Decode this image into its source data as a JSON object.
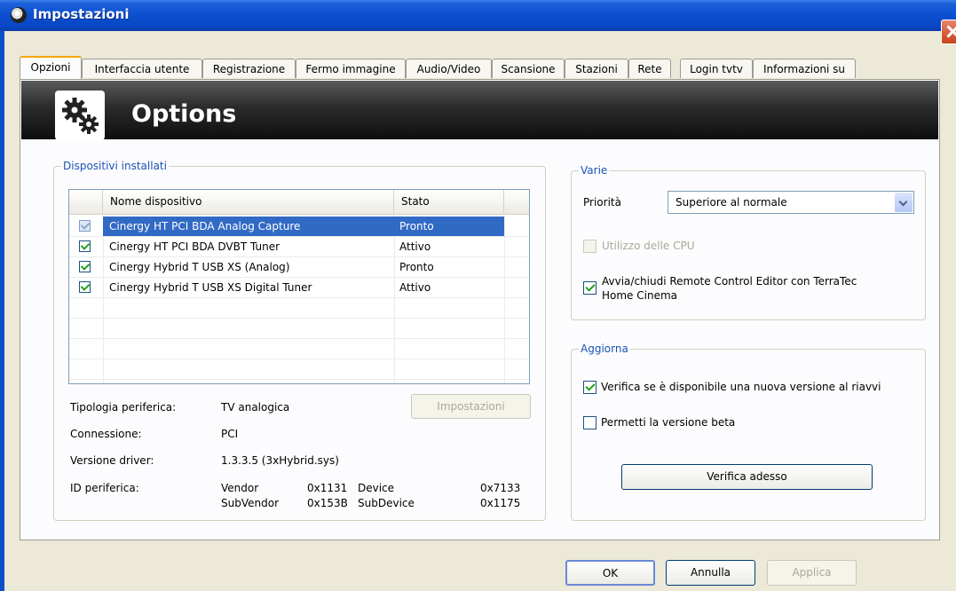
{
  "window": {
    "title": "Impostazioni"
  },
  "tabs": [
    {
      "label": "Opzioni",
      "active": true
    },
    {
      "label": "Interfaccia utente"
    },
    {
      "label": "Registrazione"
    },
    {
      "label": "Fermo immagine"
    },
    {
      "label": "Audio/Video"
    },
    {
      "label": "Scansione"
    },
    {
      "label": "Stazioni"
    },
    {
      "label": "Rete"
    },
    {
      "label": "Login tvtv"
    },
    {
      "label": "Informazioni su"
    }
  ],
  "banner": {
    "title": "Options",
    "icon": "gears-icon"
  },
  "devices": {
    "legend": "Dispositivi installati",
    "columns": {
      "name": "Nome dispositivo",
      "state": "Stato"
    },
    "rows": [
      {
        "name": "Cinergy HT PCI BDA Analog Capture",
        "state": "Pronto",
        "checked": true,
        "selected": true
      },
      {
        "name": "Cinergy HT PCI BDA DVBT Tuner",
        "state": "Attivo",
        "checked": true
      },
      {
        "name": "Cinergy Hybrid T USB XS (Analog)",
        "state": "Pronto",
        "checked": true
      },
      {
        "name": "Cinergy Hybrid T USB XS Digital Tuner",
        "state": "Attivo",
        "checked": true
      }
    ],
    "settings_button": "Impostazioni",
    "info": {
      "type_label": "Tipologia periferica:",
      "type_value": "TV analogica",
      "connection_label": "Connessione:",
      "connection_value": "PCI",
      "driver_label": "Versione driver:",
      "driver_value": "1.3.3.5 (3xHybrid.sys)",
      "id_label": "ID periferica:",
      "vendor_label": "Vendor",
      "vendor_value": "0x1131",
      "device_label": "Device",
      "device_value": "0x7133",
      "subvendor_label": "SubVendor",
      "subvendor_value": "0x153B",
      "subdevice_label": "SubDevice",
      "subdevice_value": "0x1175"
    }
  },
  "misc": {
    "legend": "Varie",
    "priority_label": "Priorità",
    "priority_value": "Superiore al normale",
    "cpu_label": "Utilizzo delle CPU",
    "remote_label_1": "Avvia/chiudi Remote Control Editor con TerraTec",
    "remote_label_2": "Home Cinema"
  },
  "update": {
    "legend": "Aggiorna",
    "check_label": "Verifica se è disponibile una nuova versione al riavvi",
    "beta_label": "Permetti la versione beta",
    "check_now": "Verifica adesso"
  },
  "footer": {
    "ok": "OK",
    "cancel": "Annulla",
    "apply": "Applica"
  }
}
